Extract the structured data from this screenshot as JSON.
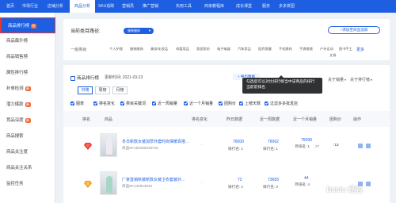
{
  "topnav": {
    "items": [
      "首页",
      "市场行业",
      "店铺分析",
      "商品分析",
      "SKU追踪",
      "营销员",
      "推广营销",
      "实用工具",
      "商家教程库",
      "成长课堂",
      "服务",
      "多多拼团"
    ],
    "active_index": 3,
    "sku_badge": "新"
  },
  "sidebar": {
    "items": [
      {
        "label": "商品排行榜",
        "badge": "热"
      },
      {
        "label": "商品飙升榜",
        "badge": ""
      },
      {
        "label": "商品销售榜",
        "badge": ""
      },
      {
        "label": "属性排行榜",
        "badge": ""
      },
      {
        "label": "补单检测",
        "badge": "新"
      },
      {
        "label": "潜力爆款",
        "badge": "新"
      },
      {
        "label": "竞品深度",
        "badge": "新"
      },
      {
        "label": "商品搜索",
        "badge": ""
      },
      {
        "label": "商品关注度",
        "badge": ""
      },
      {
        "label": "商品关注关系",
        "badge": ""
      },
      {
        "label": "监控任务",
        "badge": ""
      }
    ],
    "active_index": 0
  },
  "category": {
    "path_label": "当前类目路径:",
    "path_value": "服装服饰",
    "add_track_button": "+添加至商品追踪",
    "row_label": "一级类目:",
    "options": [
      "个人护理",
      "服装服饰",
      "美妆/化妆品",
      "母婴用品",
      "家居家纺",
      "电子电器",
      "汽车用品",
      "医药保健",
      "手机数码",
      "手表眼镜",
      "户外运动",
      "文具",
      "图书手工"
    ],
    "more": "更多"
  },
  "main": {
    "title": "商品排行榜",
    "date_label": "更新时间: 2021-03-23",
    "tabs": [
      "日榜",
      "周榜",
      "月榜"
    ],
    "active_tab": 0,
    "tooltip": "勾选后可以对比排行榜当中该商品的排行当前前排名",
    "action_button": "+ 导出数据",
    "about_sales": "关于销量",
    "about_ranking": "关于排行榜",
    "checkboxes": [
      "图表",
      "排名变化",
      "类目关键词",
      "近一周销量",
      "近一个月销量",
      "团购价",
      "上榜天数",
      "过滤多多批发店"
    ],
    "columns": [
      "排名",
      "商品",
      "排名变化",
      "昨日数据",
      "近一周数据",
      "近一个月销量",
      "团购价",
      "操作"
    ],
    "rows": [
      {
        "name": "冬日新款女装加厚外套时尚保暖百搭...",
        "id": "商品ID:150160433715",
        "yesterday": "76000",
        "yesterday_sub": "排行名: 1",
        "week": "76062",
        "week_sub": "排行名: 1",
        "month": "76099",
        "month_sub": "月排名: 1",
        "month_extra": "27",
        "price": "13",
        "rank_color": "#e8352f",
        "figure_color": "#efeaf0"
      },
      {
        "name": "厂家直销秋装新款女装卫衣套装外...",
        "id": "商品ID:142914534",
        "yesterday": "72",
        "yesterday_sub": "排行名: 2",
        "week": "73683",
        "week_sub": "排行名: 3",
        "month": "44",
        "month_sub": "月排名: 4",
        "month_extra": "",
        "price": "",
        "rank_color": "#f0a020",
        "figure_color": "#a8d6c4"
      }
    ]
  },
  "watermark": "Baidu 经验"
}
